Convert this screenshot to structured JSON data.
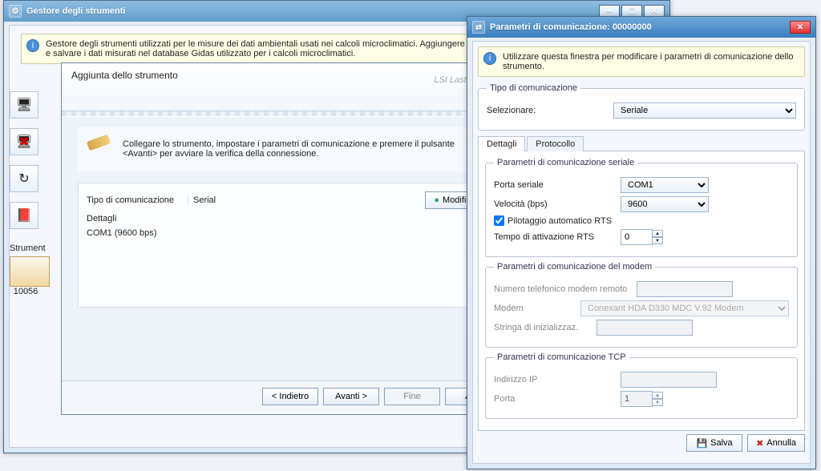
{
  "mainWin": {
    "title": "Gestore degli strumenti",
    "info": "Gestore degli strumenti utilizzati per le misure dei dati ambientali usati nei calcoli microclimatici. Aggiungere lo strumento alla cambiare la configurazione e salvare i dati misurati nel database Gidas utilizzato per i calcoli microclimatici.",
    "strumentiLabel": "Strument",
    "thumbLabel": "10056"
  },
  "wizard": {
    "title": "Aggiunta dello strumento",
    "brand": "LSI Lastem",
    "instruction": "Collegare lo strumento, impostare i parametri di comunicazione e premere il pulsante <Avanti> per avviare la verifica della connessione.",
    "commTypeLabel": "Tipo di comunicazione",
    "commTypeValue": "Serial",
    "modify": "Modifica",
    "detailsLabel": "Dettagli",
    "detailsValue": "COM1 (9600 bps)",
    "btnBack": "< Indietro",
    "btnNext": "Avanti >",
    "btnFinish": "Fine",
    "btnCancel": "Ann"
  },
  "dlg": {
    "title": "Parametri di comunicazione:  00000000",
    "info": "Utilizzare questa finestra per modificare i parametri di comunicazione dello strumento.",
    "groupCommType": "Tipo di comunicazione",
    "selectLabel": "Selezionare:",
    "selectValue": "Seriale",
    "tabDetails": "Dettagli",
    "tabProtocol": "Protocollo",
    "groupSerial": "Parametri di comunicazione seriale",
    "portLabel": "Porta seriale",
    "portValue": "COM1",
    "speedLabel": "Velocità (bps)",
    "speedValue": "9600",
    "rtsAutoLabel": "Pilotaggio automatico RTS",
    "rtsAutoChecked": true,
    "rtsTimeLabel": "Tempo di attivazione RTS",
    "rtsTimeValue": "0",
    "groupModem": "Parametri di comunicazione del modem",
    "modemPhoneLabel": "Numero telefonico modem remoto",
    "modemLabel": "Modem",
    "modemValue": "Conexant HDA D330 MDC V.92 Modem",
    "modemInitLabel": "Stringa di inizializzaz.",
    "groupTcp": "Parametri di comunicazione TCP",
    "ipLabel": "Indirizzo IP",
    "tcpPortLabel": "Porta",
    "tcpPortValue": "1",
    "btnSave": "Salva",
    "btnCancel": "Annulla"
  }
}
